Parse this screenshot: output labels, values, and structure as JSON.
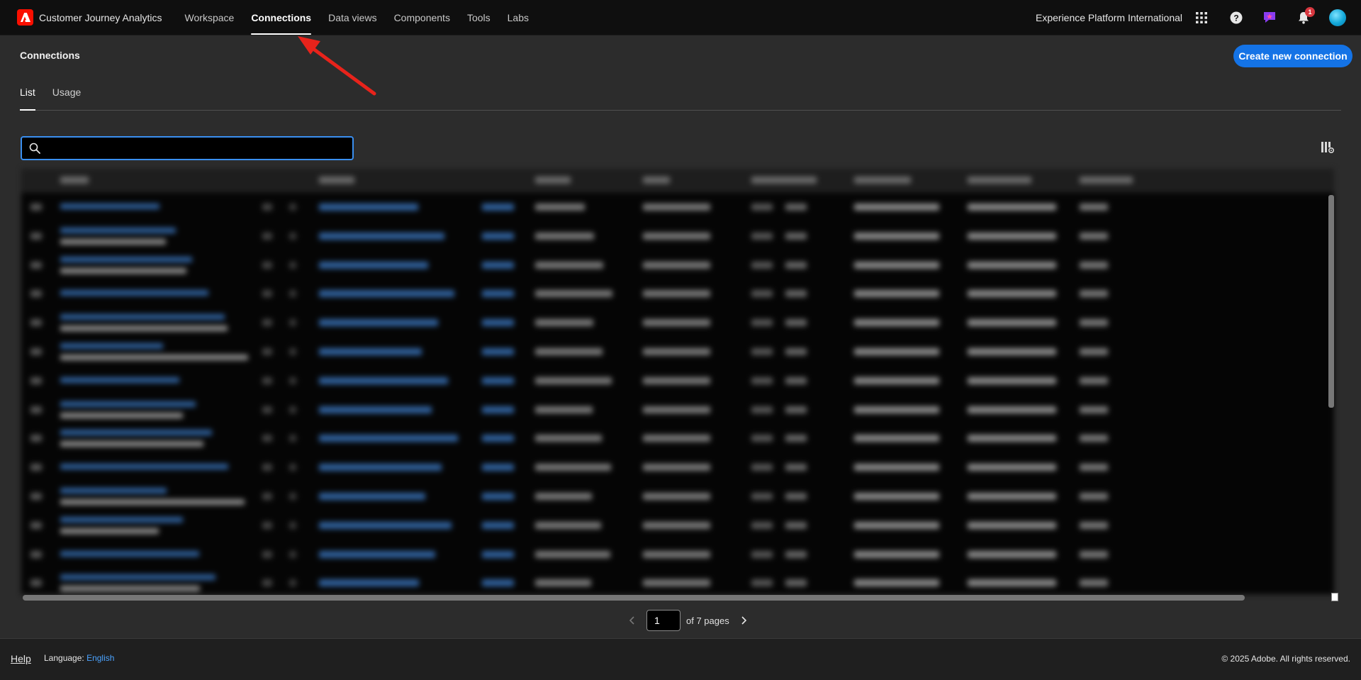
{
  "app": {
    "title": "Customer Journey Analytics",
    "brand_color": "#fa0f00"
  },
  "nav": {
    "items": [
      {
        "label": "Workspace",
        "active": false
      },
      {
        "label": "Connections",
        "active": true
      },
      {
        "label": "Data views",
        "active": false
      },
      {
        "label": "Components",
        "active": false
      },
      {
        "label": "Tools",
        "active": false
      },
      {
        "label": "Labs",
        "active": false
      }
    ]
  },
  "header": {
    "org_name": "Experience Platform International",
    "notification_count": "1",
    "icons": [
      "apps-grid-icon",
      "help-icon",
      "feedback-icon",
      "bell-icon",
      "avatar"
    ]
  },
  "page": {
    "title": "Connections",
    "create_button": "Create new connection",
    "accent_color": "#1473e6"
  },
  "tabs": [
    {
      "label": "List",
      "active": true
    },
    {
      "label": "Usage",
      "active": false
    }
  ],
  "search": {
    "value": "",
    "placeholder": ""
  },
  "table": {
    "content_obscured": true
  },
  "pagination": {
    "current_page": "1",
    "of_label": "of 7 pages"
  },
  "footer": {
    "help": "Help",
    "language_label": "Language:",
    "language_value": "English",
    "copyright": "© 2025 Adobe. All rights reserved."
  },
  "annotation": {
    "arrow_color": "#e8231b"
  }
}
